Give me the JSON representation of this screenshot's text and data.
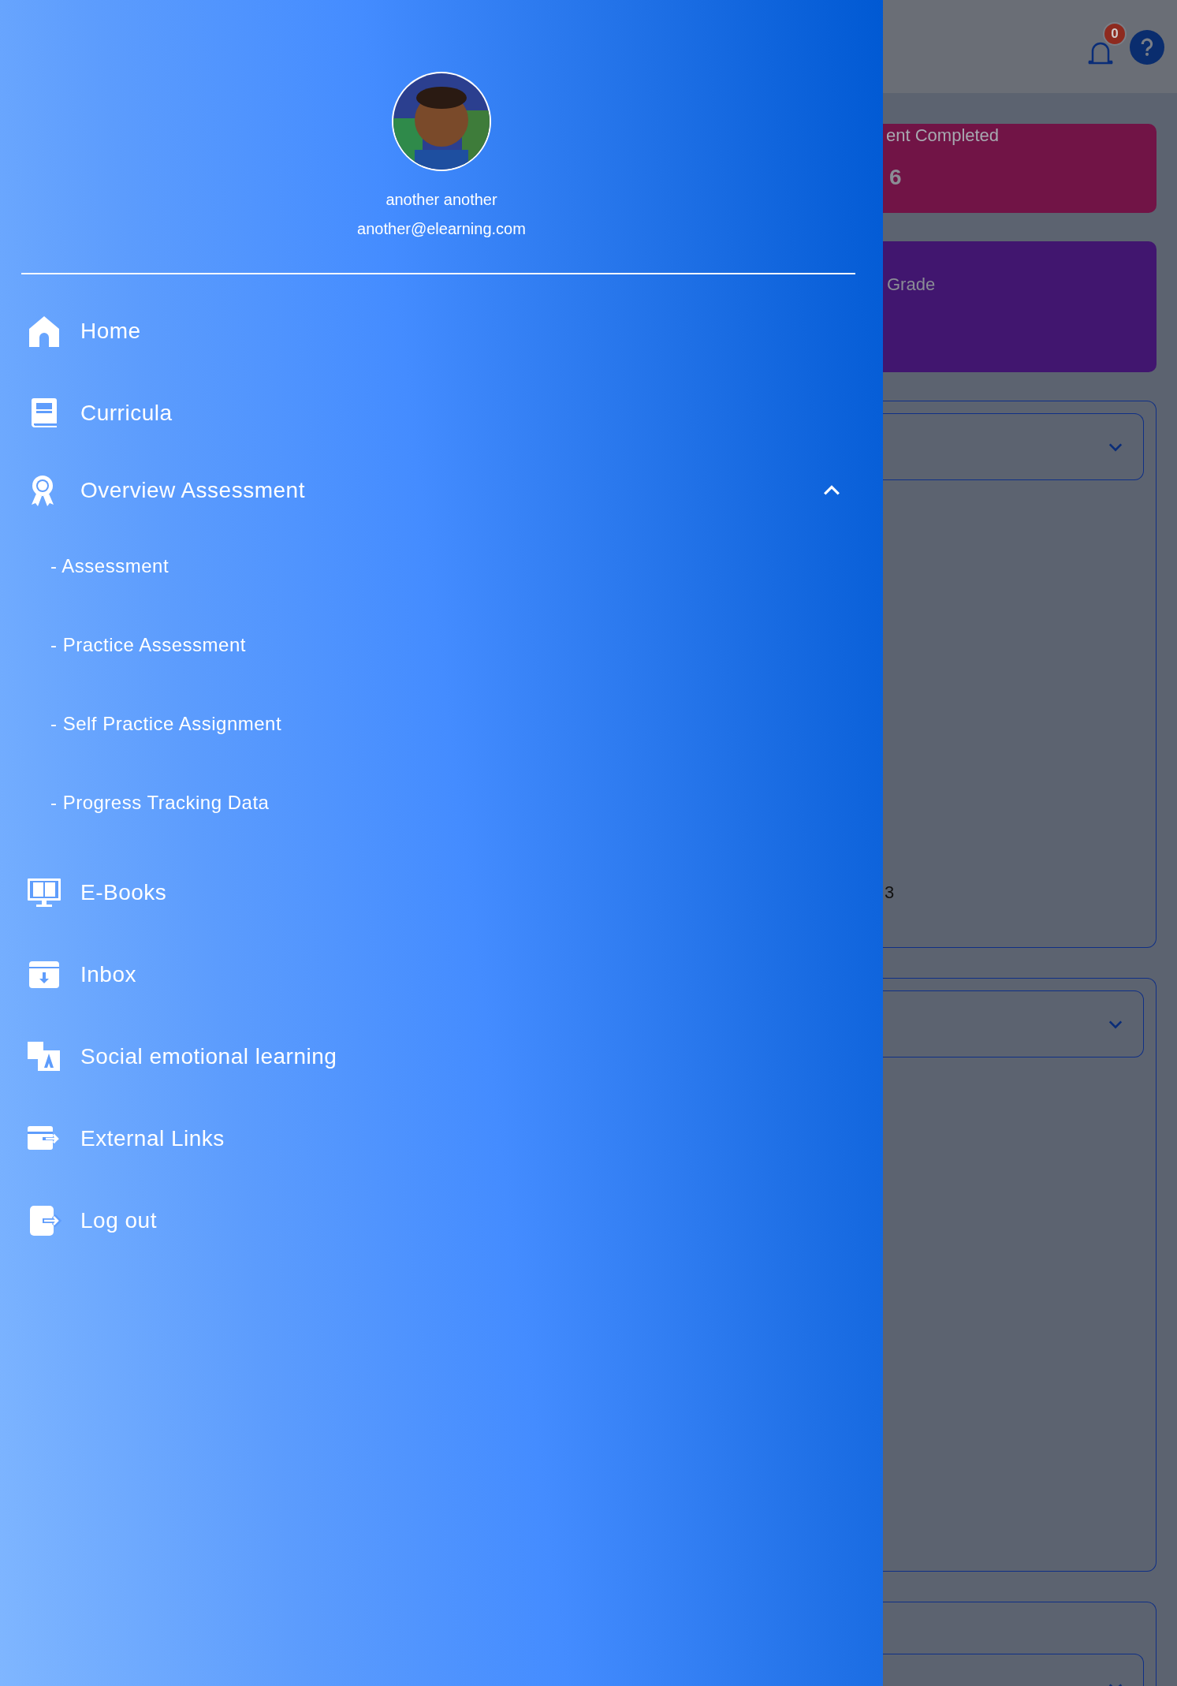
{
  "profile": {
    "name": "another another",
    "email": "another@elearning.com"
  },
  "menu": [
    {
      "label": "Home"
    },
    {
      "label": "Curricula"
    },
    {
      "label": "Overview Assessment",
      "expanded": true,
      "children": [
        {
          "label": "- Assessment"
        },
        {
          "label": "- Practice Assessment"
        },
        {
          "label": "- Self Practice Assignment"
        },
        {
          "label": "- Progress Tracking Data"
        }
      ]
    },
    {
      "label": "E-Books"
    },
    {
      "label": "Inbox"
    },
    {
      "label": "Social emotional learning"
    },
    {
      "label": "External Links"
    },
    {
      "label": "Log out"
    }
  ],
  "header": {
    "notification_count": "0"
  },
  "cards": [
    {
      "label": "ent Completed",
      "value": "6",
      "color": "#711446"
    },
    {
      "label": "Grade",
      "color": "#41166f"
    }
  ],
  "panels": [
    {
      "kind": "dropdown-panel",
      "value": "3"
    },
    {
      "kind": "dropdown-panel"
    },
    {
      "kind": "dropdown-panel"
    }
  ]
}
